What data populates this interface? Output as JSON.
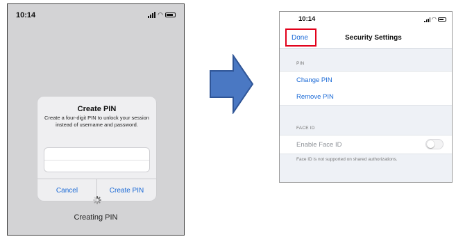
{
  "left_screen": {
    "status_time": "10:14",
    "dialog": {
      "title": "Create PIN",
      "message": "Create a four-digit PIN to unlock your session instead of username and password.",
      "cancel_label": "Cancel",
      "create_label": "Create PIN"
    },
    "status_text": "Creating PIN"
  },
  "right_screen": {
    "status_time": "10:14",
    "nav": {
      "done_label": "Done",
      "title": "Security Settings"
    },
    "pin_section": {
      "header": "PIN",
      "items": [
        {
          "label": "Change PIN"
        },
        {
          "label": "Remove PIN"
        }
      ]
    },
    "face_id_section": {
      "header": "FACE ID",
      "toggle_label": "Enable Face ID",
      "toggle_on": false,
      "footnote": "Face ID is not supported on shared authorizations."
    }
  },
  "colors": {
    "link_blue": "#1868d6",
    "highlight_red": "#e2001a",
    "arrow_fill": "#4a78c3"
  }
}
